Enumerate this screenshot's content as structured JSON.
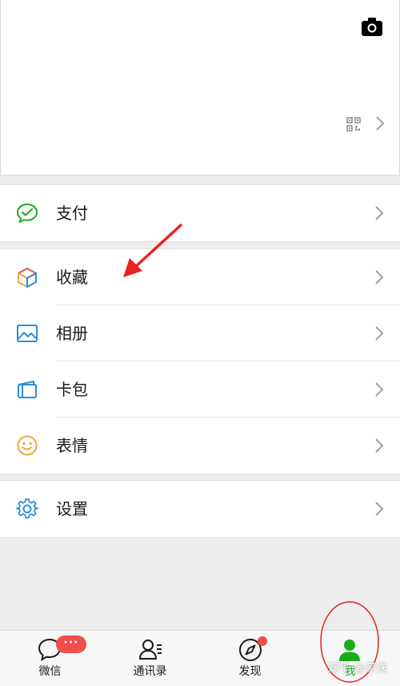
{
  "header": {
    "camera_icon": "camera-icon",
    "qrcode_icon": "qrcode-icon"
  },
  "menu": {
    "pay": {
      "label": "支付",
      "icon": "wechat-pay-icon",
      "color": "#1aad19"
    },
    "favorites": {
      "label": "收藏",
      "icon": "cube-icon"
    },
    "album": {
      "label": "相册",
      "icon": "photo-icon",
      "color": "#2a8fd6"
    },
    "cards": {
      "label": "卡包",
      "icon": "card-wallet-icon",
      "color": "#2a8fd6"
    },
    "stickers": {
      "label": "表情",
      "icon": "smiley-icon",
      "color": "#f0a73a"
    },
    "settings": {
      "label": "设置",
      "icon": "gear-icon",
      "color": "#2a8fd6"
    }
  },
  "tabbar": {
    "tabs": [
      {
        "label": "微信",
        "icon": "chat-bubble-icon",
        "badge": "···"
      },
      {
        "label": "通讯录",
        "icon": "contacts-icon"
      },
      {
        "label": "发现",
        "icon": "compass-icon"
      },
      {
        "label": "我",
        "icon": "person-icon"
      }
    ],
    "active_color": "#1aad19",
    "badge_color": "#f04d4d"
  },
  "watermark": "知乎 @豪逸"
}
